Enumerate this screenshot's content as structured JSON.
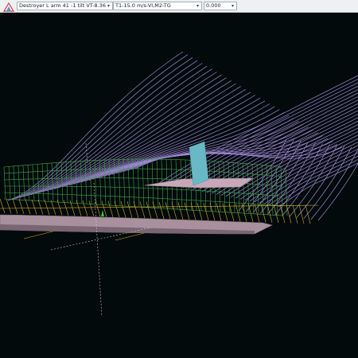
{
  "toolbar": {
    "app_icon": "sail-app-icon",
    "model_select": {
      "value": "Destroyer L arm 41 -1 tilt VT-8.36"
    },
    "case_select": {
      "value": "T1-15.0 m/s-VI,M2-TG"
    },
    "value_select": {
      "value": "0.000"
    }
  },
  "viewport": {
    "background": "#030a0c",
    "colors": {
      "streamlines": "#a88ee0",
      "grid": "#3fa34a",
      "waterline": "#d8b020",
      "hull": "#a8909e",
      "deck_plate": "#c8a8b8",
      "fin": "#69b8c6",
      "axis": "#c8c8c8"
    }
  }
}
